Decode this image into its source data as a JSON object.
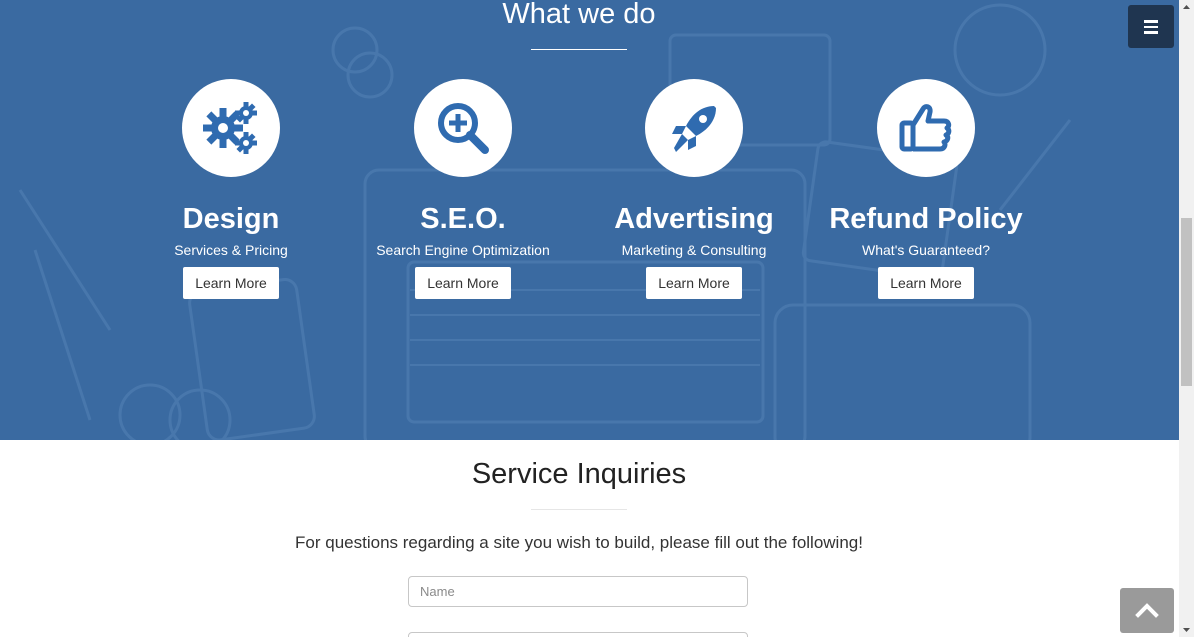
{
  "hero": {
    "title": "What we do",
    "background_color": "#3a6aa1",
    "services": [
      {
        "icon": "gears-icon",
        "title": "Design",
        "subtitle": "Services & Pricing",
        "button": "Learn More"
      },
      {
        "icon": "search-plus-icon",
        "title": "S.E.O.",
        "subtitle": "Search Engine Optimization",
        "button": "Learn More"
      },
      {
        "icon": "rocket-icon",
        "title": "Advertising",
        "subtitle": "Marketing & Consulting",
        "button": "Learn More"
      },
      {
        "icon": "thumbs-up-icon",
        "title": "Refund Policy",
        "subtitle": "What's Guaranteed?",
        "button": "Learn More"
      }
    ]
  },
  "inquiries": {
    "title": "Service Inquiries",
    "intro": "For questions regarding a site you wish to build, please fill out the following!",
    "name_placeholder": "Name",
    "second_field_placeholder": ""
  },
  "colors": {
    "accent": "#2f6bb0",
    "menu_button": "#1f3550",
    "scroll_top_button": "#9a9a9a"
  },
  "controls": {
    "menu_icon": "hamburger-icon",
    "scroll_top_icon": "chevron-up-icon"
  }
}
